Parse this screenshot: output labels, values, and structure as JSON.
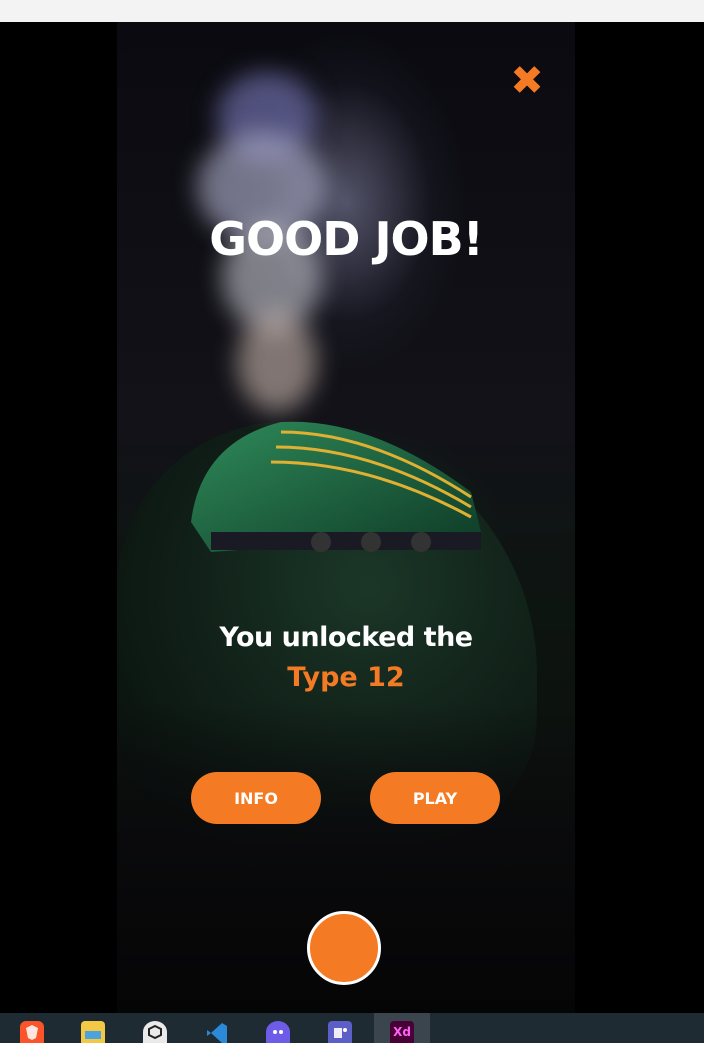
{
  "modal": {
    "title": "GOOD JOB!",
    "message": "You unlocked the",
    "unlocked_item": "Type 12",
    "close_glyph": "✖",
    "info_label": "INFO",
    "play_label": "PLAY"
  },
  "colors": {
    "accent": "#f47b24",
    "text": "#ffffff",
    "taskbar": "#1f2b33"
  },
  "taskbar": {
    "apps": [
      {
        "icon": "brave-browser-icon"
      },
      {
        "icon": "file-explorer-icon"
      },
      {
        "icon": "unity-hub-icon"
      },
      {
        "icon": "vscode-icon"
      },
      {
        "icon": "chat-app-icon"
      },
      {
        "icon": "teams-icon"
      },
      {
        "icon": "adobe-xd-icon",
        "label": "Xd",
        "active": true
      }
    ]
  }
}
